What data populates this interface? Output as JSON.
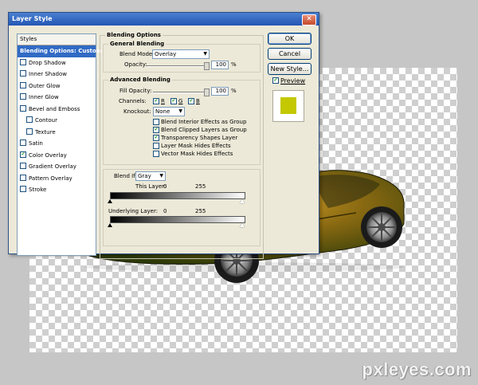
{
  "dialog": {
    "title": "Layer Style",
    "close": "✕"
  },
  "styles_list": {
    "header": "Styles",
    "items": [
      {
        "label": "Blending Options: Custom",
        "selected": true,
        "checkbox": false,
        "checked": false
      },
      {
        "label": "Drop Shadow",
        "checkbox": true,
        "checked": false
      },
      {
        "label": "Inner Shadow",
        "checkbox": true,
        "checked": false
      },
      {
        "label": "Outer Glow",
        "checkbox": true,
        "checked": false
      },
      {
        "label": "Inner Glow",
        "checkbox": true,
        "checked": false
      },
      {
        "label": "Bevel and Emboss",
        "checkbox": true,
        "checked": false
      },
      {
        "label": "Contour",
        "checkbox": true,
        "checked": false,
        "indent": true
      },
      {
        "label": "Texture",
        "checkbox": true,
        "checked": false,
        "indent": true
      },
      {
        "label": "Satin",
        "checkbox": true,
        "checked": false
      },
      {
        "label": "Color Overlay",
        "checkbox": true,
        "checked": true
      },
      {
        "label": "Gradient Overlay",
        "checkbox": true,
        "checked": false
      },
      {
        "label": "Pattern Overlay",
        "checkbox": true,
        "checked": false
      },
      {
        "label": "Stroke",
        "checkbox": true,
        "checked": false
      }
    ]
  },
  "blending_options": {
    "title": "Blending Options",
    "general": {
      "title": "General Blending",
      "blend_mode_label": "Blend Mode:",
      "blend_mode_value": "Overlay",
      "opacity_label": "Opacity:",
      "opacity_value": "100",
      "opacity_unit": "%",
      "opacity_level": 1.0
    },
    "advanced": {
      "title": "Advanced Blending",
      "fill_opacity_label": "Fill Opacity:",
      "fill_opacity_value": "100",
      "fill_opacity_unit": "%",
      "fill_opacity_level": 1.0,
      "channels_label": "Channels:",
      "channels": [
        {
          "label": "R",
          "checked": true
        },
        {
          "label": "G",
          "checked": true
        },
        {
          "label": "B",
          "checked": true
        }
      ],
      "knockout_label": "Knockout:",
      "knockout_value": "None",
      "options": [
        {
          "label": "Blend Interior Effects as Group",
          "checked": false
        },
        {
          "label": "Blend Clipped Layers as Group",
          "checked": true
        },
        {
          "label": "Transparency Shapes Layer",
          "checked": true
        },
        {
          "label": "Layer Mask Hides Effects",
          "checked": false
        },
        {
          "label": "Vector Mask Hides Effects",
          "checked": false
        }
      ]
    },
    "blend_if": {
      "label": "Blend If:",
      "value": "Gray",
      "this_layer_label": "This Layer:",
      "this_layer_low": "0",
      "this_layer_high": "255",
      "underlying_label": "Underlying Layer:",
      "underlying_low": "0",
      "underlying_high": "255"
    }
  },
  "buttons": {
    "ok": "OK",
    "cancel": "Cancel",
    "new_style": "New Style...",
    "preview_label": "Preview",
    "preview_checked": true
  },
  "colors": {
    "swatch": "#c3c800",
    "selection": "#316ac5"
  },
  "watermark": "pxleyes.com"
}
